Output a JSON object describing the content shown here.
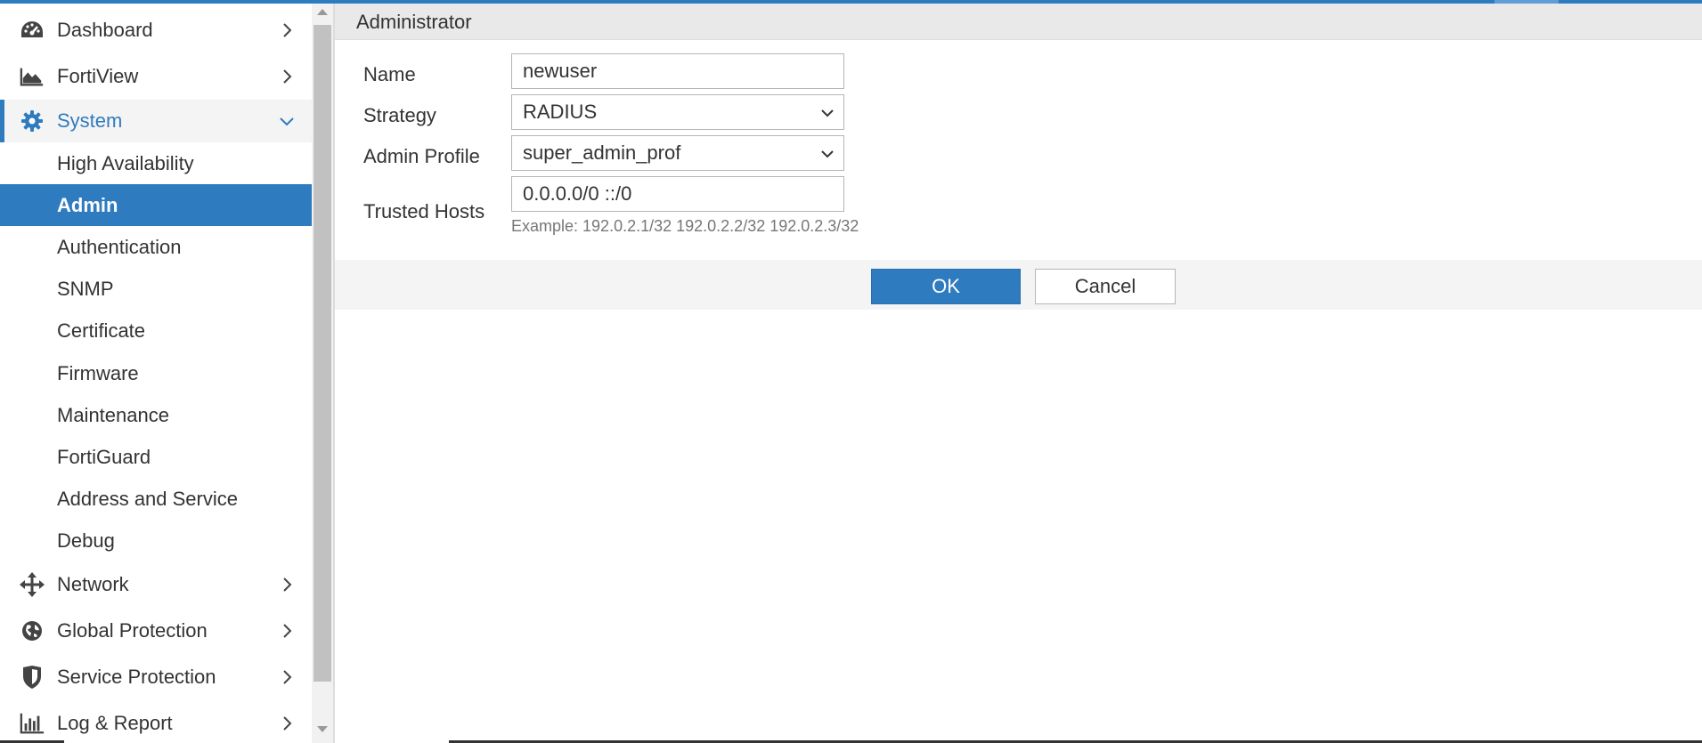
{
  "sidebar": {
    "items": [
      {
        "label": "Dashboard",
        "icon": "dashboard-icon"
      },
      {
        "label": "FortiView",
        "icon": "area-chart-icon"
      },
      {
        "label": "System",
        "icon": "gear-icon"
      },
      {
        "label": "Network",
        "icon": "move-arrows-icon"
      },
      {
        "label": "Global Protection",
        "icon": "globe-icon"
      },
      {
        "label": "Service Protection",
        "icon": "shield-icon"
      },
      {
        "label": "Log & Report",
        "icon": "bar-chart-icon"
      }
    ],
    "system_sub": [
      "High Availability",
      "Admin",
      "Authentication",
      "SNMP",
      "Certificate",
      "Firmware",
      "Maintenance",
      "FortiGuard",
      "Address and Service",
      "Debug"
    ],
    "selected_sub": "Admin"
  },
  "main": {
    "title": "Administrator",
    "form": {
      "name_label": "Name",
      "name_value": "newuser",
      "strategy_label": "Strategy",
      "strategy_value": "RADIUS",
      "profile_label": "Admin Profile",
      "profile_value": "super_admin_prof",
      "trusted_label": "Trusted Hosts",
      "trusted_value": "0.0.0.0/0 ::/0",
      "trusted_hint": "Example: 192.0.2.1/32 192.0.2.2/32 192.0.2.3/32"
    },
    "buttons": {
      "ok": "OK",
      "cancel": "Cancel"
    }
  },
  "colors": {
    "accent": "#2f7bbf",
    "header_bg": "#e9e9e9",
    "button_bar_bg": "#f4f4f4"
  }
}
